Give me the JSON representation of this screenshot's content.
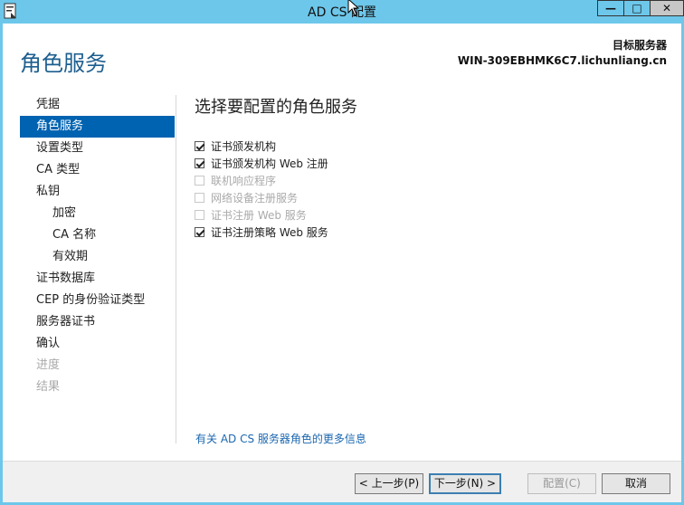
{
  "window": {
    "title": "AD CS 配置",
    "controls": {
      "min": "—",
      "max": "□",
      "close": "✕"
    },
    "colors": {
      "titlebar": "#6dc7ea",
      "accent": "#0063b1"
    }
  },
  "header": {
    "page_title": "角色服务",
    "target_label": "目标服务器",
    "target_server": "WIN-309EBHMK6C7.lichunliang.cn"
  },
  "sidebar": {
    "items": [
      {
        "label": "凭据",
        "state": "normal"
      },
      {
        "label": "角色服务",
        "state": "active"
      },
      {
        "label": "设置类型",
        "state": "normal"
      },
      {
        "label": "CA 类型",
        "state": "normal"
      },
      {
        "label": "私钥",
        "state": "normal"
      },
      {
        "label": "加密",
        "state": "sub"
      },
      {
        "label": "CA 名称",
        "state": "sub"
      },
      {
        "label": "有效期",
        "state": "sub"
      },
      {
        "label": "证书数据库",
        "state": "normal"
      },
      {
        "label": "CEP 的身份验证类型",
        "state": "normal"
      },
      {
        "label": "服务器证书",
        "state": "normal"
      },
      {
        "label": "确认",
        "state": "normal"
      },
      {
        "label": "进度",
        "state": "disabled"
      },
      {
        "label": "结果",
        "state": "disabled"
      }
    ]
  },
  "main": {
    "section_title": "选择要配置的角色服务",
    "roles": [
      {
        "label": "证书颁发机构",
        "checked": true,
        "enabled": true
      },
      {
        "label": "证书颁发机构 Web 注册",
        "checked": true,
        "enabled": true
      },
      {
        "label": "联机响应程序",
        "checked": false,
        "enabled": false
      },
      {
        "label": "网络设备注册服务",
        "checked": false,
        "enabled": false
      },
      {
        "label": "证书注册 Web 服务",
        "checked": false,
        "enabled": false
      },
      {
        "label": "证书注册策略 Web 服务",
        "checked": true,
        "enabled": true
      }
    ],
    "more_info_link": "有关 AD CS 服务器角色的更多信息"
  },
  "footer": {
    "prev": "< 上一步(P)",
    "next": "下一步(N) >",
    "configure": "配置(C)",
    "cancel": "取消"
  }
}
